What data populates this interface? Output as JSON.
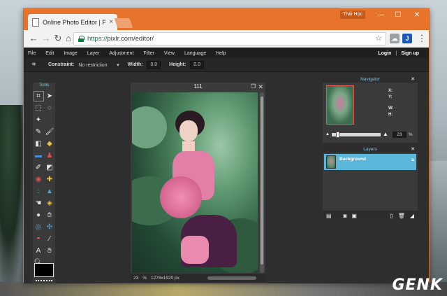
{
  "browser": {
    "tab_title": "Online Photo Editor | Pix",
    "tab_close": "×",
    "user_badge": "Thái Học",
    "window_controls": [
      "—",
      "☐",
      "✕"
    ],
    "url_scheme": "https://",
    "url_rest": "pixlr.com/editor/",
    "extensions": [
      {
        "icon": "cloud-extension-icon",
        "color": "#9aa0a6"
      },
      {
        "icon": "jdownloader-extension-icon",
        "label": "J",
        "color": "#1a57b8"
      }
    ]
  },
  "menu": {
    "items": [
      "File",
      "Edit",
      "Image",
      "Layer",
      "Adjustment",
      "Filter",
      "View",
      "Language",
      "Help"
    ],
    "login": "Login",
    "signup": "Sign up"
  },
  "options": {
    "constraint_label": "Constraint:",
    "constraint_value": "No restriction",
    "width_label": "Width:",
    "width_value": "0.0",
    "height_label": "Height:",
    "height_value": "0.0"
  },
  "tools": {
    "title": "Tools",
    "icons": [
      "crop-icon",
      "move-icon",
      "marquee-icon",
      "lasso-icon",
      "wand-icon",
      "blank",
      "pencil-icon",
      "brush-icon",
      "eraser-icon",
      "bucket-icon",
      "gradient-icon",
      "clone-stamp-icon",
      "replace-color-icon",
      "drawing-icon",
      "red-eye-icon",
      "spot-heal-icon",
      "blur-icon",
      "sharpen-icon",
      "smudge-icon",
      "sponge-icon",
      "dodge-icon",
      "burn-icon",
      "bloat-icon",
      "pinch-icon",
      "eye-icon",
      "eyedropper-icon",
      "type-icon",
      "hand-icon",
      "zoom-icon",
      "blank"
    ],
    "primary_color": "#000000"
  },
  "document": {
    "title": "111",
    "zoom": "23",
    "dimensions": "1278x1920 px"
  },
  "navigator": {
    "title": "Navigator",
    "x_label": "X:",
    "y_label": "Y:",
    "w_label": "W:",
    "h_label": "H:",
    "zoom": "23",
    "zoom_unit": "%"
  },
  "layers": {
    "title": "Layers",
    "items": [
      {
        "name": "Background",
        "locked": true
      }
    ]
  },
  "watermark": "GENK"
}
